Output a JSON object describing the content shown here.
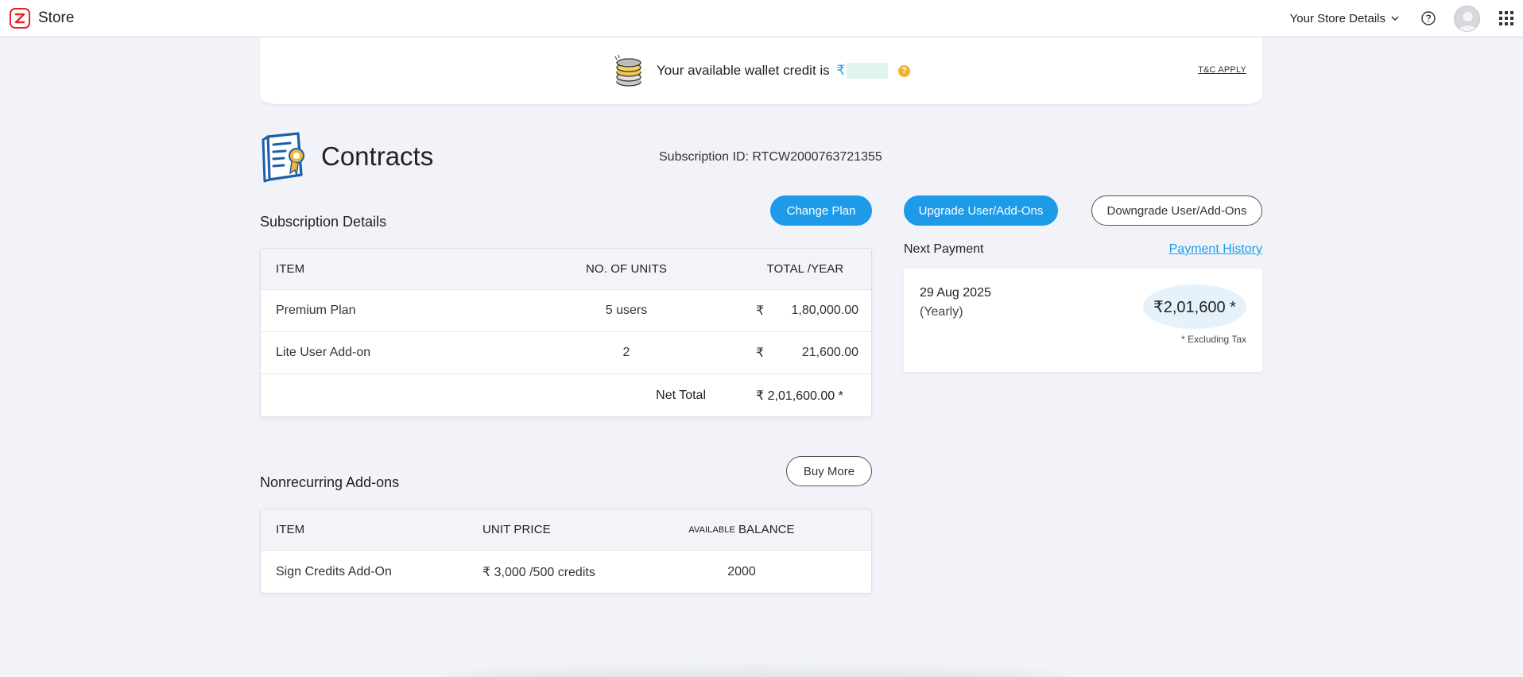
{
  "topbar": {
    "app_name": "Store",
    "store_details": "Your Store Details"
  },
  "wallet": {
    "text": "Your available wallet credit is",
    "currency": "₹",
    "help": "?",
    "tnc": "T&C APPLY"
  },
  "header": {
    "title": "Contracts",
    "subscription_id": "Subscription ID: RTCW2000763721355"
  },
  "actions": {
    "change_plan": "Change Plan",
    "upgrade": "Upgrade User/Add-Ons",
    "downgrade": "Downgrade User/Add-Ons",
    "buy_more": "Buy More"
  },
  "subscription": {
    "title": "Subscription Details",
    "headers": {
      "item": "ITEM",
      "units": "NO. OF UNITS",
      "total": "TOTAL /YEAR"
    },
    "rows": [
      {
        "item": "Premium Plan",
        "units": "5 users",
        "currency": "₹",
        "total": "1,80,000.00"
      },
      {
        "item": "Lite User Add-on",
        "units": "2",
        "currency": "₹",
        "total": "21,600.00"
      }
    ],
    "net_total_label": "Net Total",
    "net_total_value": "₹ 2,01,600.00 *"
  },
  "nonrecurring": {
    "title": "Nonrecurring Add-ons",
    "headers": {
      "item": "ITEM",
      "unit_price": "UNIT PRICE",
      "available_small": "AVAILABLE",
      "balance": "BALANCE"
    },
    "rows": [
      {
        "item": "Sign Credits Add-On",
        "unit_price": "₹ 3,000 /500 credits",
        "balance": "2000"
      }
    ]
  },
  "next_payment": {
    "label": "Next Payment",
    "history_link": "Payment History",
    "date": "29 Aug 2025",
    "cycle": "(Yearly)",
    "amount": "₹2,01,600 *",
    "tax_note": "* Excluding Tax"
  }
}
